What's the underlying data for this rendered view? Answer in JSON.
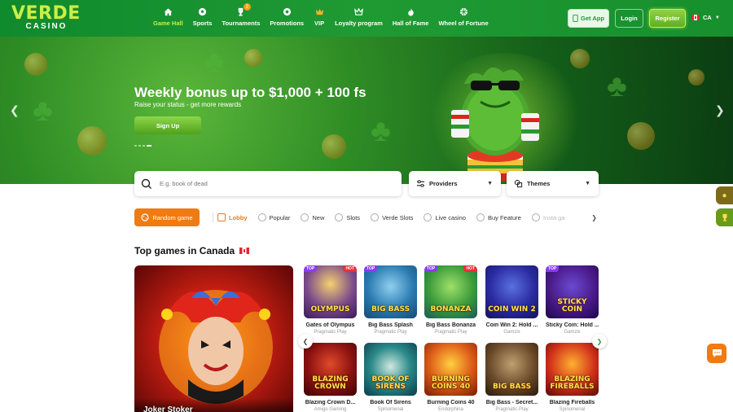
{
  "brand": {
    "name": "VERDE",
    "subtitle": "CASINO"
  },
  "nav": [
    {
      "label": "Game Hall",
      "icon": "home-icon",
      "active": true
    },
    {
      "label": "Sports",
      "icon": "soccer-ball-icon"
    },
    {
      "label": "Tournaments",
      "icon": "trophy-icon",
      "badge": "2"
    },
    {
      "label": "Promotions",
      "icon": "gift-icon"
    },
    {
      "label": "VIP",
      "icon": "crown-icon"
    },
    {
      "label": "Loyalty program",
      "icon": "crown-outline-icon"
    },
    {
      "label": "Hall of Fame",
      "icon": "flame-icon"
    },
    {
      "label": "Wheel of Fortune",
      "icon": "wheel-icon"
    }
  ],
  "header_actions": {
    "get_app": "Get App",
    "login": "Login",
    "register": "Register",
    "language": "CA"
  },
  "banner": {
    "title": "Weekly bonus up to $1,000 + 100 fs",
    "subtitle": "Raise your status - get more rewards",
    "cta": "Sign Up",
    "slides": 4,
    "active_slide": 4
  },
  "search": {
    "placeholder": "E.g. book of dead"
  },
  "filters": {
    "providers": "Providers",
    "themes": "Themes"
  },
  "categories": {
    "random": "Random game",
    "items": [
      {
        "label": "Lobby",
        "active": true
      },
      {
        "label": "Popular"
      },
      {
        "label": "New"
      },
      {
        "label": "Slots"
      },
      {
        "label": "Verde Slots"
      },
      {
        "label": "Live casino"
      },
      {
        "label": "Buy Feature"
      },
      {
        "label": "Insta ga"
      }
    ]
  },
  "section": {
    "title": "Top games in Canada"
  },
  "featured": {
    "name": "Joker Stoker"
  },
  "games": [
    {
      "name": "Gates of Olympus",
      "provider": "Pragmatic Play",
      "art": "OLYMPUS",
      "top": true,
      "hot": true
    },
    {
      "name": "Big Bass Splash",
      "provider": "Pragmatic Play",
      "art": "BIG BASS",
      "top": true,
      "hot": false
    },
    {
      "name": "Big Bass Bonanza",
      "provider": "Pragmatic Play",
      "art": "BONANZA",
      "top": true,
      "hot": true
    },
    {
      "name": "Coin Win 2: Hold ...",
      "provider": "Gamzix",
      "art": "COIN WIN 2",
      "top": false,
      "hot": false
    },
    {
      "name": "Sticky Coin: Hold ...",
      "provider": "Gamzix",
      "art": "STICKY COIN",
      "top": true,
      "hot": false
    },
    {
      "name": "Blazing Crown D...",
      "provider": "Amigo Gaming",
      "art": "BLAZING CROWN",
      "top": false,
      "hot": false
    },
    {
      "name": "Book Of Sirens",
      "provider": "Spinomenal",
      "art": "BOOK OF SIRENS",
      "top": false,
      "hot": false
    },
    {
      "name": "Burning Coins 40",
      "provider": "Endorphina",
      "art": "BURNING COINS 40",
      "top": false,
      "hot": false
    },
    {
      "name": "Big Bass - Secret...",
      "provider": "Pragmatic Play",
      "art": "BIG BASS",
      "top": false,
      "hot": false
    },
    {
      "name": "Blazing Fireballs",
      "provider": "Spinomenal",
      "art": "BLAZING FIREBALLS",
      "top": false,
      "hot": false
    }
  ],
  "tags": {
    "top": "TOP",
    "hot": "HOT"
  },
  "colors": {
    "brand_green": "#1a9a33",
    "accent_lime": "#c6f04a",
    "orange": "#f07b12"
  }
}
